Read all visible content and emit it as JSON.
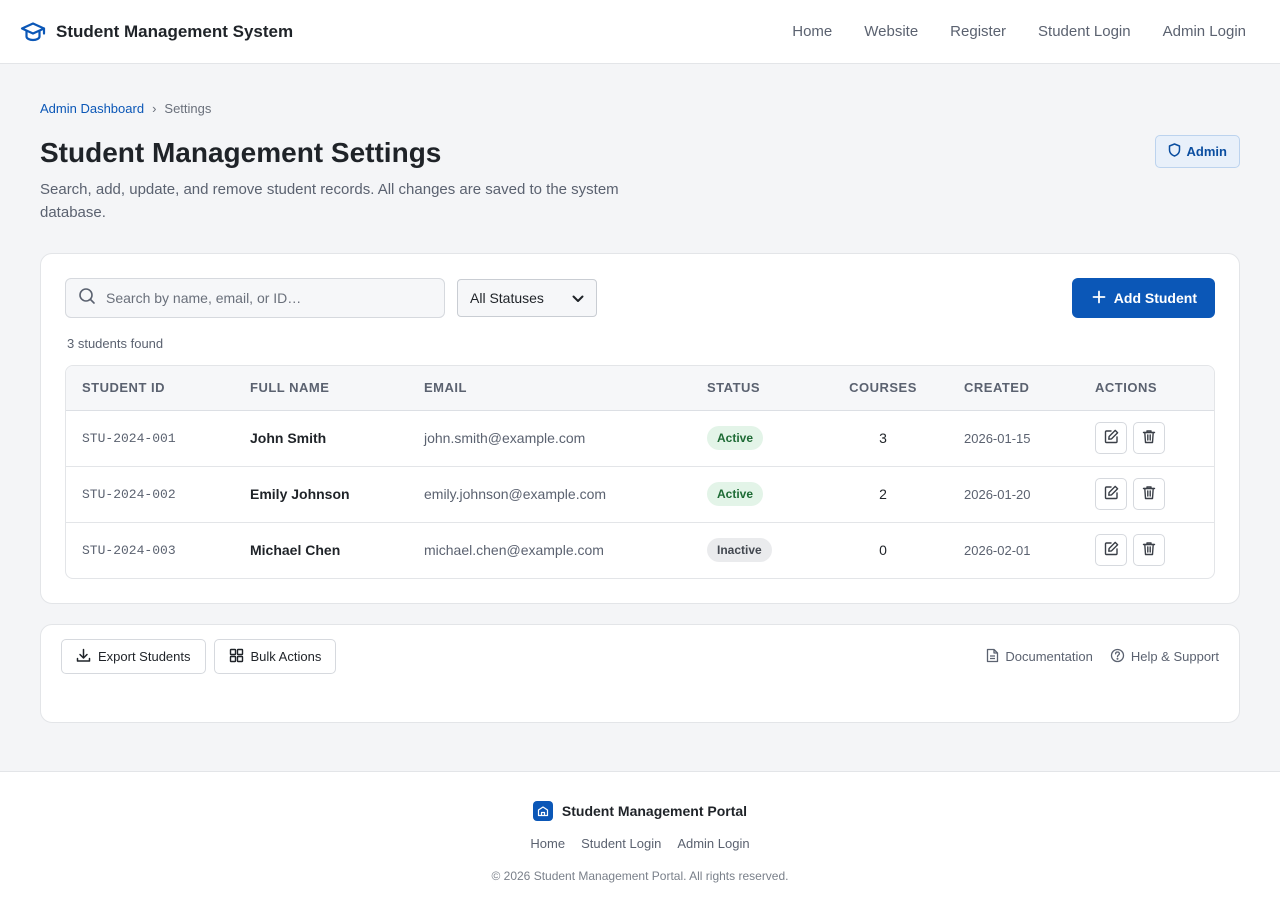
{
  "header": {
    "brand_name": "Student Management System",
    "brand_icon": "graduation-cap-icon",
    "nav": [
      "Home",
      "Website",
      "Register",
      "Student Login",
      "Admin Login"
    ]
  },
  "breadcrumb": {
    "parent": "Admin Dashboard",
    "separator": "›",
    "current": "Settings"
  },
  "page": {
    "title": "Student Management Settings",
    "description": "Search, add, update, and remove student records. All changes are saved to the system database.",
    "role_badge": "Admin",
    "role_icon": "shield-icon"
  },
  "toolbar": {
    "search_placeholder": "Search by name, email, or ID…",
    "status_filter": "All Statuses",
    "add_label": "Add Student"
  },
  "results": {
    "count_text": "3 students found"
  },
  "table": {
    "columns": [
      "STUDENT ID",
      "FULL NAME",
      "EMAIL",
      "STATUS",
      "COURSES",
      "CREATED",
      "ACTIONS"
    ],
    "rows": [
      {
        "id": "STU-2024-001",
        "name": "John Smith",
        "email": "john.smith@example.com",
        "status": "Active",
        "status_kind": "active",
        "courses": "3",
        "created": "2026-01-15"
      },
      {
        "id": "STU-2024-002",
        "name": "Emily Johnson",
        "email": "emily.johnson@example.com",
        "status": "Active",
        "status_kind": "active",
        "courses": "2",
        "created": "2026-01-20"
      },
      {
        "id": "STU-2024-003",
        "name": "Michael Chen",
        "email": "michael.chen@example.com",
        "status": "Inactive",
        "status_kind": "inactive",
        "courses": "0",
        "created": "2026-02-01"
      }
    ]
  },
  "tools": {
    "export_label": "Export Students",
    "bulk_label": "Bulk Actions",
    "docs_label": "Documentation",
    "help_label": "Help & Support"
  },
  "footer": {
    "brand_name": "Student Management Portal",
    "nav": [
      "Home",
      "Student Login",
      "Admin Login"
    ],
    "copyright": "© 2026 Student Management Portal. All rights reserved."
  },
  "colors": {
    "accent": "#0b57b7",
    "active_bg": "#e3f4e8",
    "active_text": "#1e6b35",
    "inactive_bg": "#eaebed"
  }
}
